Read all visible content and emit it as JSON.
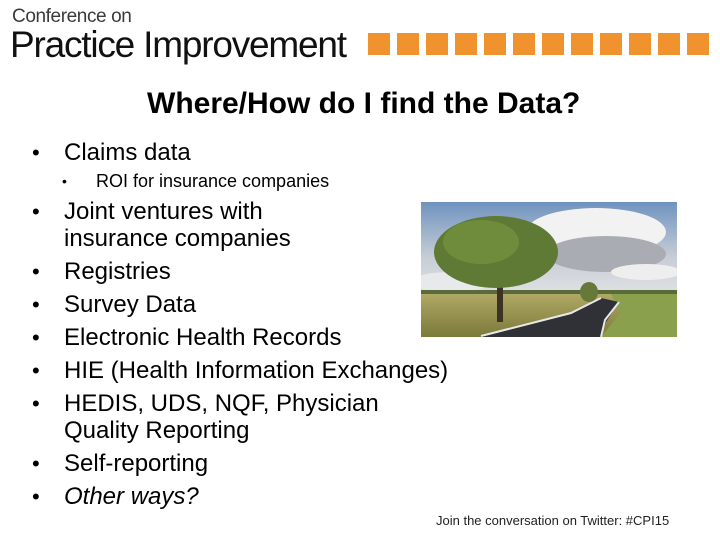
{
  "header": {
    "logo_line1": "Conference on",
    "logo_line2": "Practice Improvement",
    "accent_color": "#f0922e",
    "square_count": 12
  },
  "slide": {
    "title": "Where/How do I find the Data?",
    "bullets": [
      {
        "text": "Claims data",
        "level": 1,
        "sub": [
          "ROI for insurance companies"
        ]
      },
      {
        "text": "Joint ventures with insurance companies",
        "level": 1
      },
      {
        "text": "Registries",
        "level": 1
      },
      {
        "text": "Survey Data",
        "level": 1
      },
      {
        "text": "Electronic Health Records",
        "level": 1
      },
      {
        "text": "HIE (Health Information Exchanges)",
        "level": 1
      },
      {
        "text": "HEDIS, UDS, NQF, Physician Quality Reporting",
        "level": 1
      },
      {
        "text": "Self-reporting",
        "level": 1
      },
      {
        "text": "Other ways?",
        "level": 1,
        "italic": true
      }
    ],
    "image": {
      "description": "country road with tree under cloudy sky",
      "icon": "landscape-photo"
    }
  },
  "footer": {
    "text": "Join the conversation on Twitter: #CPI15"
  }
}
